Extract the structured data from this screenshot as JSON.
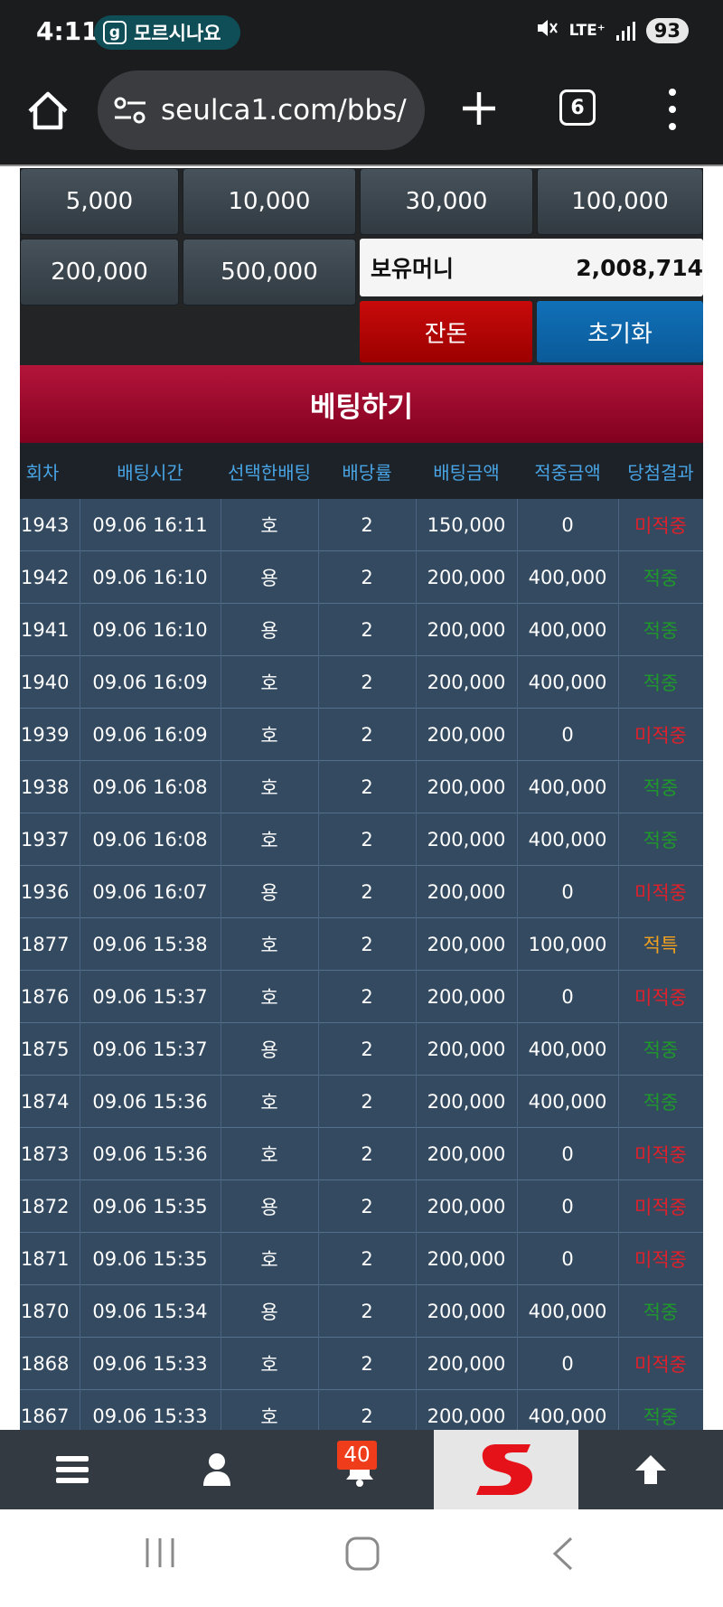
{
  "status_bar": {
    "time": "4:11",
    "notification_icon_letter": "g",
    "notification_text": "모르시나요",
    "network": "LTE⁺",
    "battery": "93"
  },
  "browser": {
    "url": "seulca1.com/bbs/",
    "tab_count": "6"
  },
  "chips": [
    "5,000",
    "10,000",
    "30,000",
    "100,000",
    "200,000",
    "500,000"
  ],
  "balance": {
    "label": "보유머니",
    "value": "2,008,714"
  },
  "buttons": {
    "change": "잔돈",
    "reset": "초기화"
  },
  "bet_header": "베팅하기",
  "table": {
    "columns": [
      "회차",
      "배팅시간",
      "선택한배팅",
      "배당률",
      "배팅금액",
      "적중금액",
      "당첨결과"
    ],
    "rows": [
      {
        "round": "1943",
        "time": "09.06 16:11",
        "pick": "호",
        "odds": "2",
        "bet": "150,000",
        "win": "0",
        "result": "미적중",
        "status": "lose"
      },
      {
        "round": "1942",
        "time": "09.06 16:10",
        "pick": "용",
        "odds": "2",
        "bet": "200,000",
        "win": "400,000",
        "result": "적중",
        "status": "win"
      },
      {
        "round": "1941",
        "time": "09.06 16:10",
        "pick": "용",
        "odds": "2",
        "bet": "200,000",
        "win": "400,000",
        "result": "적중",
        "status": "win"
      },
      {
        "round": "1940",
        "time": "09.06 16:09",
        "pick": "호",
        "odds": "2",
        "bet": "200,000",
        "win": "400,000",
        "result": "적중",
        "status": "win"
      },
      {
        "round": "1939",
        "time": "09.06 16:09",
        "pick": "호",
        "odds": "2",
        "bet": "200,000",
        "win": "0",
        "result": "미적중",
        "status": "lose"
      },
      {
        "round": "1938",
        "time": "09.06 16:08",
        "pick": "호",
        "odds": "2",
        "bet": "200,000",
        "win": "400,000",
        "result": "적중",
        "status": "win"
      },
      {
        "round": "1937",
        "time": "09.06 16:08",
        "pick": "호",
        "odds": "2",
        "bet": "200,000",
        "win": "400,000",
        "result": "적중",
        "status": "win"
      },
      {
        "round": "1936",
        "time": "09.06 16:07",
        "pick": "용",
        "odds": "2",
        "bet": "200,000",
        "win": "0",
        "result": "미적중",
        "status": "lose"
      },
      {
        "round": "1877",
        "time": "09.06 15:38",
        "pick": "호",
        "odds": "2",
        "bet": "200,000",
        "win": "100,000",
        "result": "적특",
        "status": "special"
      },
      {
        "round": "1876",
        "time": "09.06 15:37",
        "pick": "호",
        "odds": "2",
        "bet": "200,000",
        "win": "0",
        "result": "미적중",
        "status": "lose"
      },
      {
        "round": "1875",
        "time": "09.06 15:37",
        "pick": "용",
        "odds": "2",
        "bet": "200,000",
        "win": "400,000",
        "result": "적중",
        "status": "win"
      },
      {
        "round": "1874",
        "time": "09.06 15:36",
        "pick": "호",
        "odds": "2",
        "bet": "200,000",
        "win": "400,000",
        "result": "적중",
        "status": "win"
      },
      {
        "round": "1873",
        "time": "09.06 15:36",
        "pick": "호",
        "odds": "2",
        "bet": "200,000",
        "win": "0",
        "result": "미적중",
        "status": "lose"
      },
      {
        "round": "1872",
        "time": "09.06 15:35",
        "pick": "용",
        "odds": "2",
        "bet": "200,000",
        "win": "0",
        "result": "미적중",
        "status": "lose"
      },
      {
        "round": "1871",
        "time": "09.06 15:35",
        "pick": "호",
        "odds": "2",
        "bet": "200,000",
        "win": "0",
        "result": "미적중",
        "status": "lose"
      },
      {
        "round": "1870",
        "time": "09.06 15:34",
        "pick": "용",
        "odds": "2",
        "bet": "200,000",
        "win": "400,000",
        "result": "적중",
        "status": "win"
      },
      {
        "round": "1868",
        "time": "09.06 15:33",
        "pick": "호",
        "odds": "2",
        "bet": "200,000",
        "win": "0",
        "result": "미적중",
        "status": "lose"
      },
      {
        "round": "1867",
        "time": "09.06 15:33",
        "pick": "호",
        "odds": "2",
        "bet": "200,000",
        "win": "400,000",
        "result": "적중",
        "status": "win"
      }
    ]
  },
  "bottom_nav": {
    "notification_count": "40",
    "icons": [
      "menu-icon",
      "user-icon",
      "bell-icon",
      "site-logo",
      "arrow-up-icon"
    ]
  },
  "colors": {
    "lose": "#e0202a",
    "win": "#1f9a2a",
    "special": "#f0a020",
    "header_text": "#48a4e4"
  }
}
